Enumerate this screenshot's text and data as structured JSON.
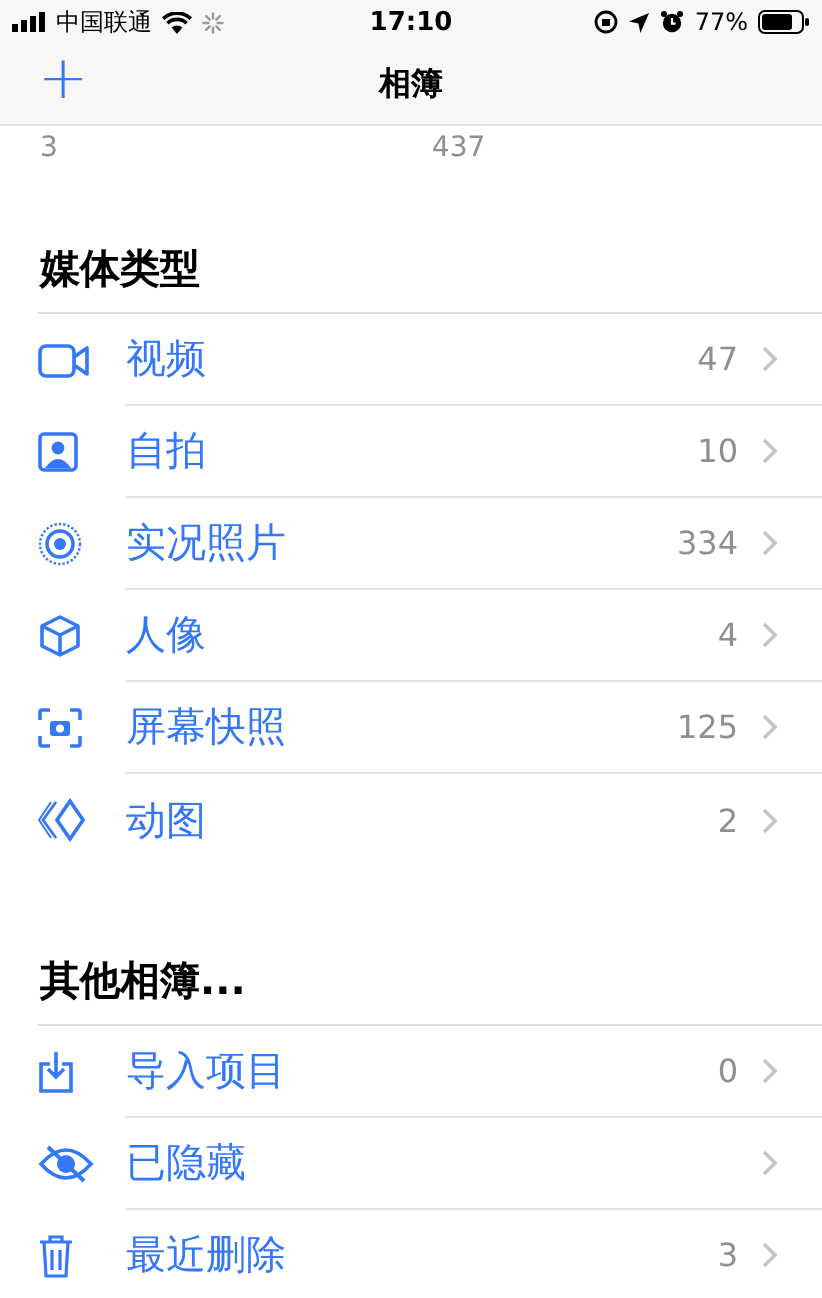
{
  "status_bar": {
    "carrier": "中国联通",
    "time": "17:10",
    "battery": "77%"
  },
  "nav": {
    "add": "+",
    "title": "相簿"
  },
  "partial_row": [
    "3",
    "437"
  ],
  "sections": [
    {
      "title": "媒体类型",
      "items": [
        {
          "label": "视频",
          "count": "47"
        },
        {
          "label": "自拍",
          "count": "10"
        },
        {
          "label": "实况照片",
          "count": "334"
        },
        {
          "label": "人像",
          "count": "4"
        },
        {
          "label": "屏幕快照",
          "count": "125"
        },
        {
          "label": "动图",
          "count": "2"
        }
      ]
    },
    {
      "title": "其他相簿...",
      "items": [
        {
          "label": "导入项目",
          "count": "0"
        },
        {
          "label": "已隐藏"
        },
        {
          "label": "最近删除",
          "count": "3"
        }
      ]
    }
  ]
}
